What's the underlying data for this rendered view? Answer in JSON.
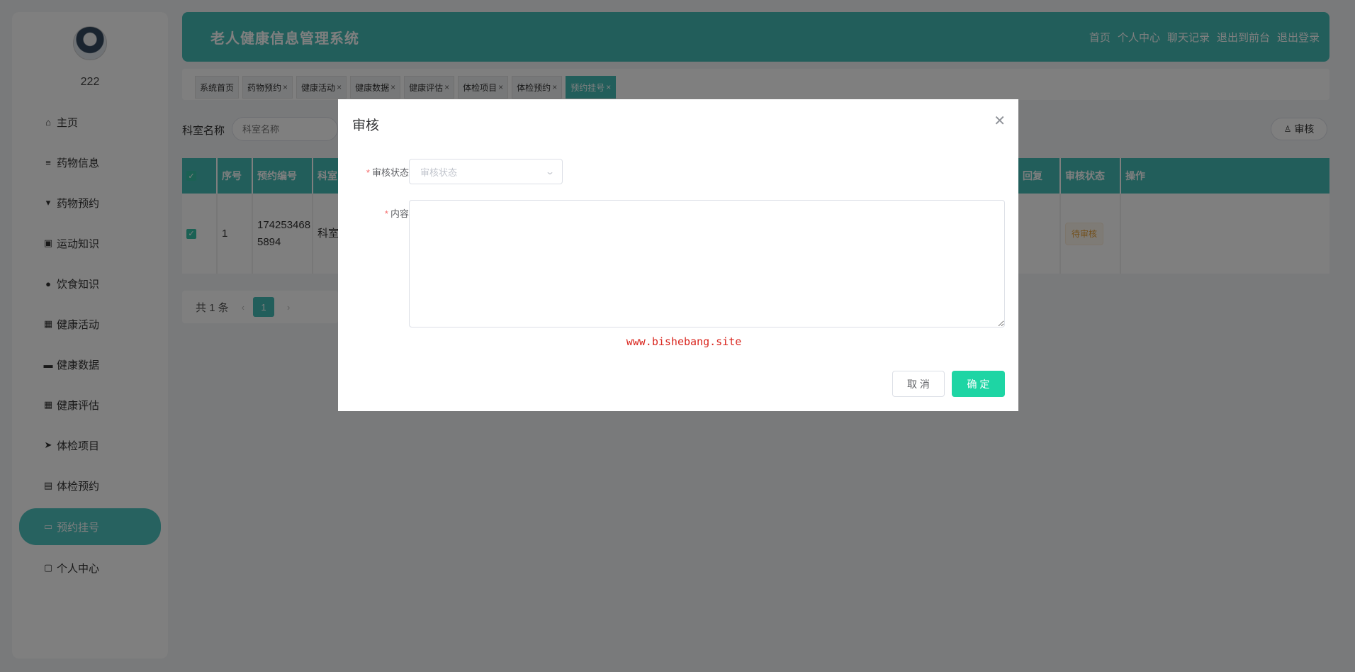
{
  "user": {
    "name": "222"
  },
  "sidebar": {
    "items": [
      {
        "label": "主页",
        "icon": "home-icon",
        "glyph": "⌂"
      },
      {
        "label": "药物信息",
        "icon": "list-icon",
        "glyph": "≡"
      },
      {
        "label": "药物预约",
        "icon": "cup-icon",
        "glyph": "▾"
      },
      {
        "label": "运动知识",
        "icon": "calendar-x-icon",
        "glyph": "▣"
      },
      {
        "label": "饮食知识",
        "icon": "user-icon",
        "glyph": "●"
      },
      {
        "label": "健康活动",
        "icon": "grid-icon",
        "glyph": "▦"
      },
      {
        "label": "健康数据",
        "icon": "box-icon",
        "glyph": "▬"
      },
      {
        "label": "健康评估",
        "icon": "grid-icon",
        "glyph": "▦"
      },
      {
        "label": "体检项目",
        "icon": "send-icon",
        "glyph": "➤"
      },
      {
        "label": "体检预约",
        "icon": "clipboard-icon",
        "glyph": "▤"
      },
      {
        "label": "预约挂号",
        "icon": "ticket-icon",
        "glyph": "▭",
        "active": true
      },
      {
        "label": "个人中心",
        "icon": "window-icon",
        "glyph": "▢"
      }
    ]
  },
  "header": {
    "title": "老人健康信息管理系统",
    "links": [
      "首页",
      "个人中心",
      "聊天记录",
      "退出到前台",
      "退出登录"
    ]
  },
  "tabs": [
    {
      "label": "系统首页",
      "closable": false
    },
    {
      "label": "药物预约",
      "closable": true
    },
    {
      "label": "健康活动",
      "closable": true
    },
    {
      "label": "健康数据",
      "closable": true
    },
    {
      "label": "健康评估",
      "closable": true
    },
    {
      "label": "体检项目",
      "closable": true
    },
    {
      "label": "体检预约",
      "closable": true
    },
    {
      "label": "预约挂号",
      "closable": true,
      "active": true
    }
  ],
  "search": {
    "label": "科室名称",
    "placeholder": "科室名称"
  },
  "toolbar": {
    "audit_label": "审核"
  },
  "table": {
    "headers": [
      "序号",
      "预约编号",
      "科室",
      "回复",
      "审核状态",
      "操作"
    ],
    "row": {
      "index": "1",
      "booking_no": "1742534685894",
      "booking_no_line1": "174253468",
      "booking_no_line2": "5894",
      "dept": "科室",
      "status": "待审核"
    }
  },
  "pagination": {
    "total": "共 1 条",
    "current": "1",
    "prev": "‹",
    "next": "›"
  },
  "dialog": {
    "title": "审核",
    "status_label": "审核状态",
    "status_placeholder": "审核状态",
    "content_label": "内容",
    "watermark": "www.bishebang.site",
    "cancel": "取 消",
    "confirm": "确 定"
  },
  "colors": {
    "accent": "#45bdb7",
    "confirm": "#1ed5a4",
    "required": "#f56c6c",
    "watermark": "#d9251d"
  }
}
